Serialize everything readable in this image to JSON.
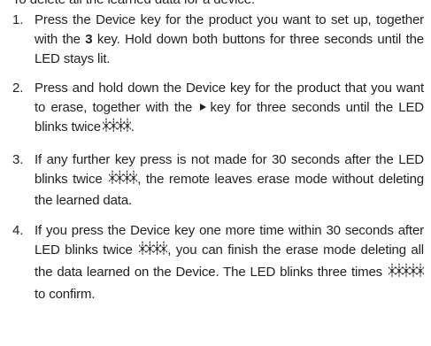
{
  "intro_text": "To delete all the learned data for a device:",
  "steps": [
    {
      "number": "1.",
      "text_a": "Press the Device key for the product you want to set up, together with the ",
      "key": "3",
      "text_b": " key. Hold down both buttons for three seconds until the LED stays lit."
    },
    {
      "number": "2.",
      "text_a": "Press and hold down the Device key for the product that you want to erase, together with the",
      "text_b": "key for three seconds until the LED blinks twice",
      "text_c": "."
    },
    {
      "number": "3.",
      "text_a": "If any further key press is not made for 30 seconds after the LED blinks twice",
      "text_b": ", the remote leaves erase mode without deleting the learned data."
    },
    {
      "number": "4.",
      "text_a": "If you press the Device key one more time within 30 seconds after LED blinks twice",
      "text_b": ", you can finish the erase mode deleting all the data learned on the Device. The LED blinks three times",
      "text_c": "to confirm."
    }
  ],
  "icons": {
    "play_arrow": "play-arrow-icon",
    "blink_twice": "led-blink-twice-icon",
    "blink_three": "led-blink-three-times-icon"
  },
  "colors": {
    "text": "#231f20"
  }
}
